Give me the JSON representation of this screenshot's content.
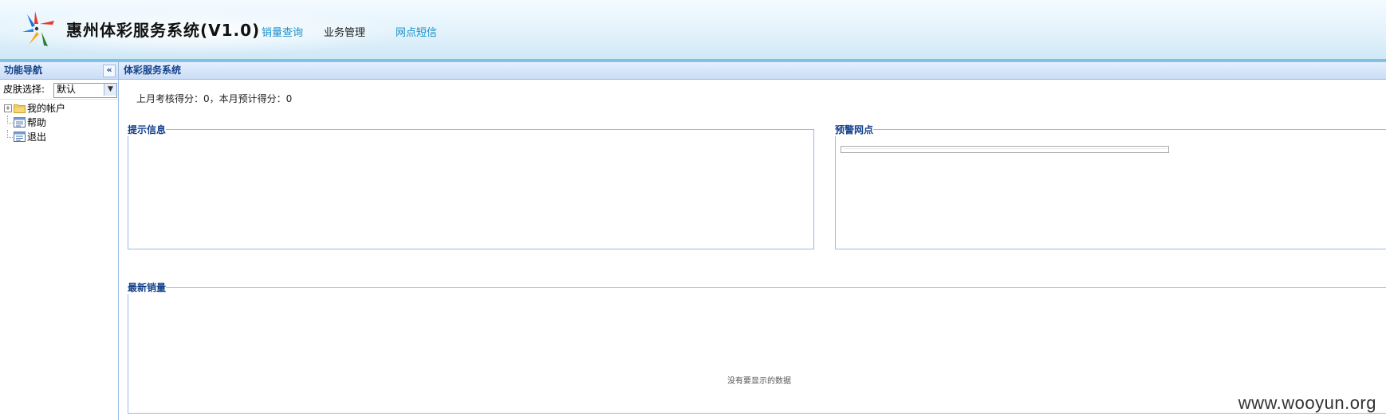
{
  "header": {
    "title": "惠州体彩服务系统(V1.0)",
    "nav": [
      {
        "label": "销量查询",
        "color": "#1a8fc9"
      },
      {
        "label": "业务管理",
        "color": "#222222"
      },
      {
        "label": "网点短信",
        "color": "#1a8fc9"
      }
    ]
  },
  "sidebar": {
    "title": "功能导航",
    "collapse_icon": "«",
    "skin_label": "皮肤选择:",
    "skin_value": "默认",
    "tree": [
      {
        "label": "我的帐户",
        "icon": "folder-icon"
      },
      {
        "label": "帮助",
        "icon": "page-icon"
      },
      {
        "label": "退出",
        "icon": "page-icon"
      }
    ]
  },
  "main": {
    "title": "体彩服务系统",
    "score_text": "上月考核得分：0，本月预计得分：0",
    "tips_legend": "提示信息",
    "warning_legend": "预警网点",
    "sales_legend": "最新销量",
    "empty_text": "没有要显示的数据"
  },
  "watermark": "www.wooyun.org",
  "colors": {
    "panel_header_text": "#15428b",
    "border": "#99bbe8",
    "link_blue": "#1a8fc9"
  }
}
